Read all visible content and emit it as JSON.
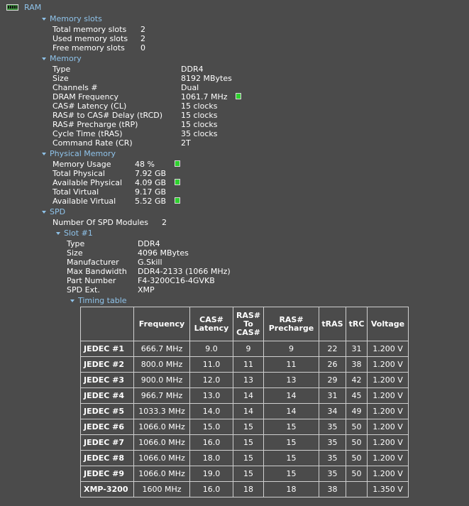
{
  "root": {
    "label": "RAM",
    "icon": "ram-module-icon"
  },
  "memory_slots": {
    "header": "Memory slots",
    "rows": [
      {
        "label": "Total memory slots",
        "value": "2"
      },
      {
        "label": "Used memory slots",
        "value": "2"
      },
      {
        "label": "Free memory slots",
        "value": "0"
      }
    ]
  },
  "memory": {
    "header": "Memory",
    "rows": [
      {
        "label": "Type",
        "value": "DDR4"
      },
      {
        "label": "Size",
        "value": "8192 MBytes"
      },
      {
        "label": "Channels #",
        "value": "Dual"
      },
      {
        "label": "DRAM Frequency",
        "value": "1061.7 MHz"
      },
      {
        "label": "CAS# Latency (CL)",
        "value": "15 clocks"
      },
      {
        "label": "RAS# to CAS# Delay (tRCD)",
        "value": "15 clocks"
      },
      {
        "label": "RAS# Precharge (tRP)",
        "value": "15 clocks"
      },
      {
        "label": "Cycle Time (tRAS)",
        "value": "35 clocks"
      },
      {
        "label": "Command Rate (CR)",
        "value": "2T"
      }
    ]
  },
  "physical_memory": {
    "header": "Physical Memory",
    "rows": [
      {
        "label": "Memory Usage",
        "value": "48 %"
      },
      {
        "label": "Total Physical",
        "value": "7.92 GB"
      },
      {
        "label": "Available Physical",
        "value": "4.09 GB"
      },
      {
        "label": "Total Virtual",
        "value": "9.17 GB"
      },
      {
        "label": "Available Virtual",
        "value": "5.52 GB"
      }
    ]
  },
  "spd": {
    "header": "SPD",
    "modules_label": "Number Of SPD Modules",
    "modules_value": "2",
    "slot": {
      "header": "Slot #1",
      "rows": [
        {
          "label": "Type",
          "value": "DDR4"
        },
        {
          "label": "Size",
          "value": "4096 MBytes"
        },
        {
          "label": "Manufacturer",
          "value": "G.Skill"
        },
        {
          "label": "Max Bandwidth",
          "value": "DDR4-2133 (1066 MHz)"
        },
        {
          "label": "Part Number",
          "value": "F4-3200C16-4GVKB"
        },
        {
          "label": "SPD Ext.",
          "value": "XMP"
        }
      ],
      "timing_header": "Timing table"
    }
  },
  "timing_table": {
    "columns": [
      "Frequency",
      "CAS# Latency",
      "RAS# To CAS#",
      "RAS# Precharge",
      "tRAS",
      "tRC",
      "Voltage"
    ],
    "rows": [
      {
        "name": "JEDEC #1",
        "cells": [
          "666.7 MHz",
          "9.0",
          "9",
          "9",
          "22",
          "31",
          "1.200 V"
        ]
      },
      {
        "name": "JEDEC #2",
        "cells": [
          "800.0 MHz",
          "11.0",
          "11",
          "11",
          "26",
          "38",
          "1.200 V"
        ]
      },
      {
        "name": "JEDEC #3",
        "cells": [
          "900.0 MHz",
          "12.0",
          "13",
          "13",
          "29",
          "42",
          "1.200 V"
        ]
      },
      {
        "name": "JEDEC #4",
        "cells": [
          "966.7 MHz",
          "13.0",
          "14",
          "14",
          "31",
          "45",
          "1.200 V"
        ]
      },
      {
        "name": "JEDEC #5",
        "cells": [
          "1033.3 MHz",
          "14.0",
          "14",
          "14",
          "34",
          "49",
          "1.200 V"
        ]
      },
      {
        "name": "JEDEC #6",
        "cells": [
          "1066.0 MHz",
          "15.0",
          "15",
          "15",
          "35",
          "50",
          "1.200 V"
        ]
      },
      {
        "name": "JEDEC #7",
        "cells": [
          "1066.0 MHz",
          "16.0",
          "15",
          "15",
          "35",
          "50",
          "1.200 V"
        ]
      },
      {
        "name": "JEDEC #8",
        "cells": [
          "1066.0 MHz",
          "18.0",
          "15",
          "15",
          "35",
          "50",
          "1.200 V"
        ]
      },
      {
        "name": "JEDEC #9",
        "cells": [
          "1066.0 MHz",
          "19.0",
          "15",
          "15",
          "35",
          "50",
          "1.200 V"
        ]
      },
      {
        "name": "XMP-3200",
        "cells": [
          "1600 MHz",
          "16.0",
          "18",
          "18",
          "38",
          "",
          "1.350 V"
        ]
      }
    ]
  },
  "colors": {
    "background": "#4b4b4b",
    "header_text": "#8fc3ea",
    "indicator": "#2ed12e"
  }
}
